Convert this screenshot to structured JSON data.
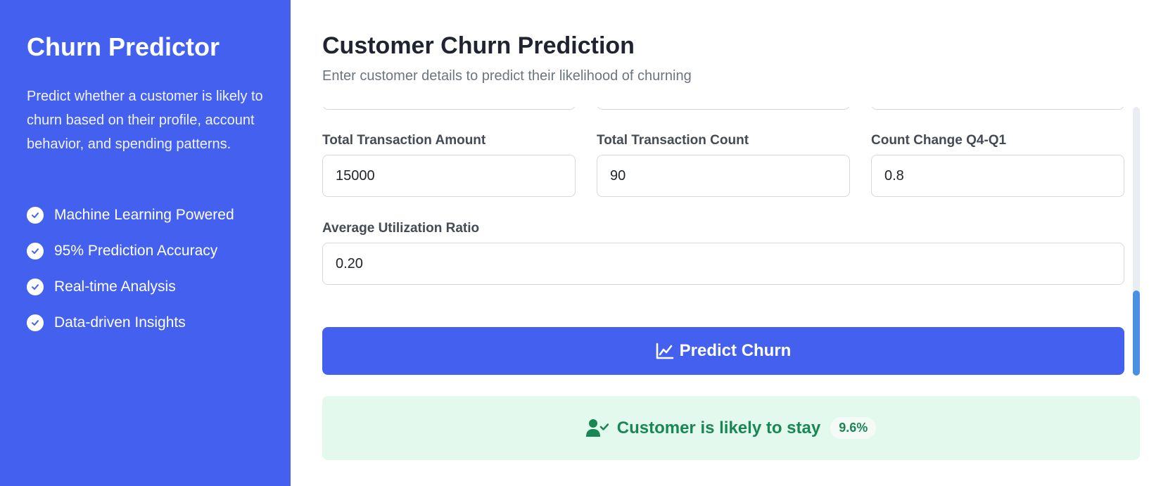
{
  "sidebar": {
    "title": "Churn Predictor",
    "description": "Predict whether a customer is likely to churn based on their profile, account behavior, and spending patterns.",
    "features": [
      {
        "label": "Machine Learning Powered",
        "icon": "check-circle-icon"
      },
      {
        "label": "95% Prediction Accuracy",
        "icon": "check-circle-icon"
      },
      {
        "label": "Real-time Analysis",
        "icon": "check-circle-icon"
      },
      {
        "label": "Data-driven Insights",
        "icon": "check-circle-icon"
      }
    ]
  },
  "main": {
    "title": "Customer Churn Prediction",
    "subtitle": "Enter customer details to predict their likelihood of churning"
  },
  "form": {
    "fields": [
      {
        "label": "Total Transaction Amount",
        "value": "15000"
      },
      {
        "label": "Total Transaction Count",
        "value": "90"
      },
      {
        "label": "Count Change Q4-Q1",
        "value": "0.8"
      },
      {
        "label": "Average Utilization Ratio",
        "value": "0.20"
      }
    ],
    "submit_label": "Predict Churn",
    "submit_icon": "chart-line-icon"
  },
  "result": {
    "icon": "user-check-icon",
    "text": "Customer is likely to stay",
    "probability": "9.6%"
  },
  "colors": {
    "primary": "#4361ee",
    "success": "#198754",
    "success_bg": "#e3f9ee",
    "scrollbar_thumb": "#4a90e2"
  }
}
